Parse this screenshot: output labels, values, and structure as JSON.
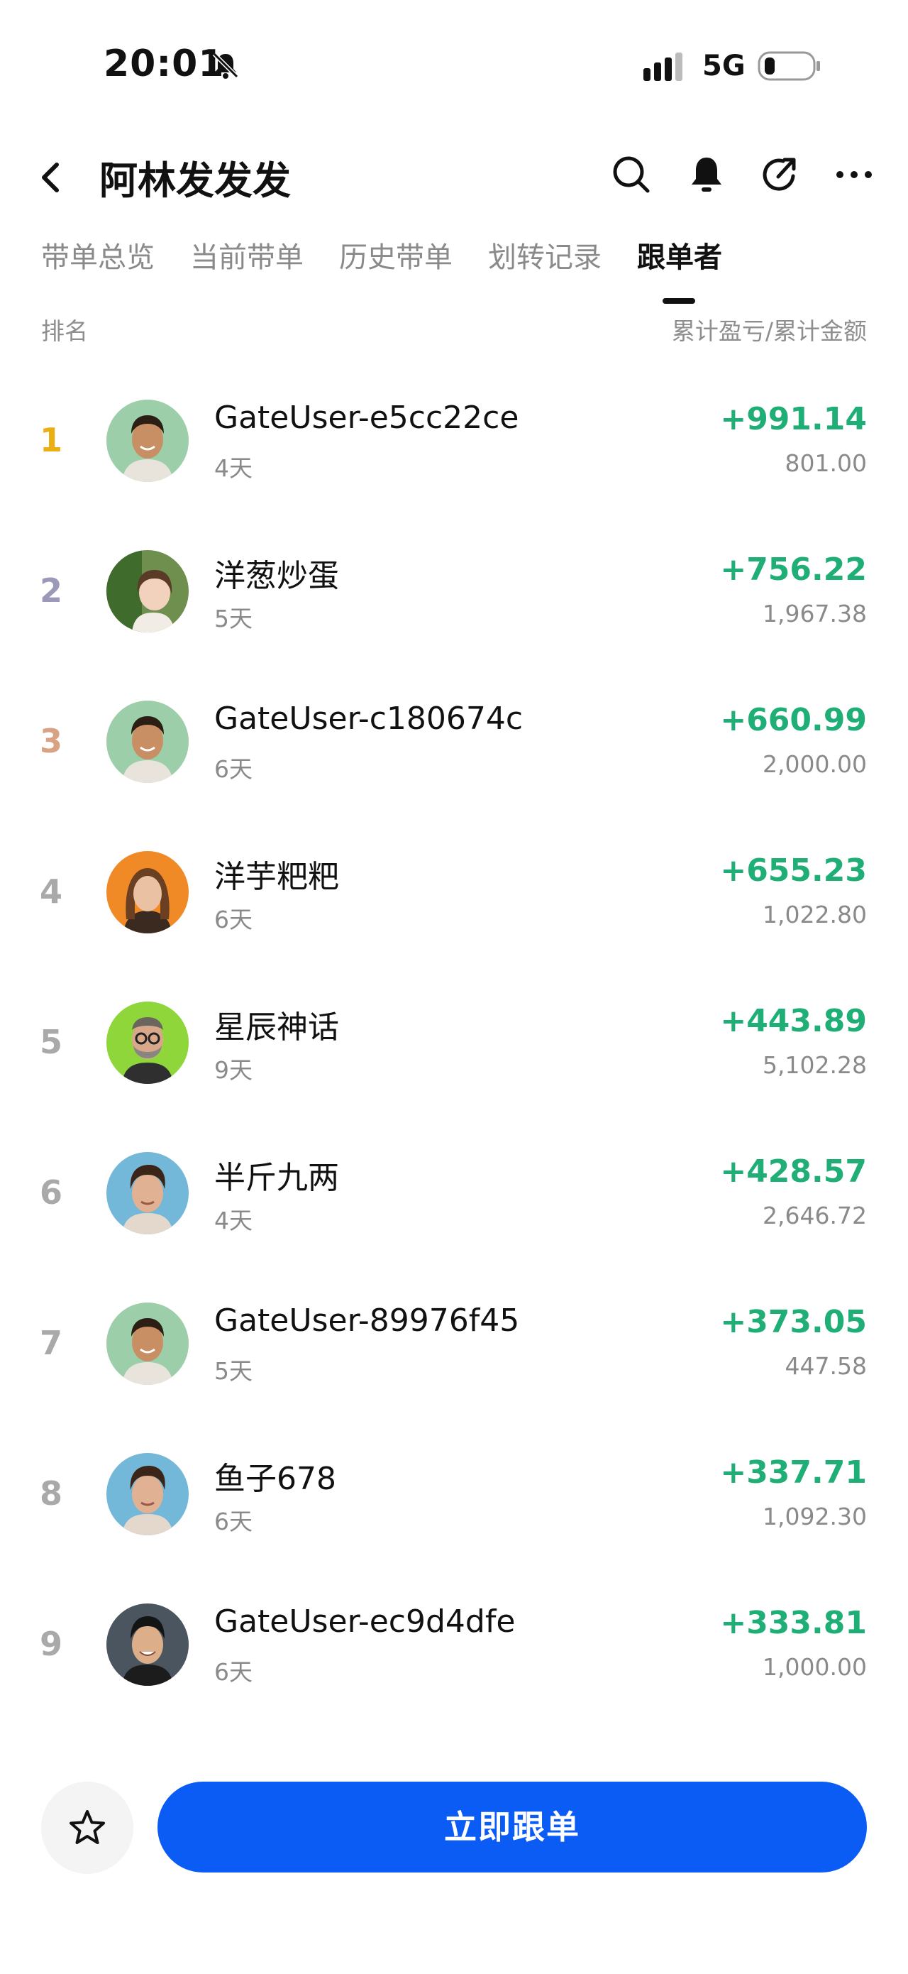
{
  "status_bar": {
    "time": "20:01",
    "network": "5G"
  },
  "header": {
    "title": "阿林发发发"
  },
  "tabs": [
    {
      "label": "带单总览"
    },
    {
      "label": "当前带单"
    },
    {
      "label": "历史带单"
    },
    {
      "label": "划转记录"
    },
    {
      "label": "跟单者"
    }
  ],
  "active_tab": "跟单者",
  "list_header": {
    "left": "排名",
    "right": "累计盈亏/累计金额"
  },
  "followers": [
    {
      "rank": "1",
      "name": "GateUser-e5cc22ce",
      "days": "4天",
      "pnl": "+991.14",
      "amount": "801.00"
    },
    {
      "rank": "2",
      "name": "洋葱炒蛋",
      "days": "5天",
      "pnl": "+756.22",
      "amount": "1,967.38"
    },
    {
      "rank": "3",
      "name": "GateUser-c180674c",
      "days": "6天",
      "pnl": "+660.99",
      "amount": "2,000.00"
    },
    {
      "rank": "4",
      "name": "洋芋粑粑",
      "days": "6天",
      "pnl": "+655.23",
      "amount": "1,022.80"
    },
    {
      "rank": "5",
      "name": "星辰神话",
      "days": "9天",
      "pnl": "+443.89",
      "amount": "5,102.28"
    },
    {
      "rank": "6",
      "name": "半斤九两",
      "days": "4天",
      "pnl": "+428.57",
      "amount": "2,646.72"
    },
    {
      "rank": "7",
      "name": "GateUser-89976f45",
      "days": "5天",
      "pnl": "+373.05",
      "amount": "447.58"
    },
    {
      "rank": "8",
      "name": "鱼子678",
      "days": "6天",
      "pnl": "+337.71",
      "amount": "1,092.30"
    },
    {
      "rank": "9",
      "name": "GateUser-ec9d4dfe",
      "days": "6天",
      "pnl": "+333.81",
      "amount": "1,000.00"
    }
  ],
  "bottom": {
    "follow_label": "立即跟单"
  },
  "colors": {
    "profit": "#1fae76",
    "primary": "#0b5bf5",
    "rank_gold": "#eab013",
    "rank_silver": "#9a9ab8",
    "rank_bronze": "#d9a383"
  },
  "icons": [
    "back-icon",
    "search-icon",
    "bell-icon",
    "share-icon",
    "more-icon",
    "star-icon",
    "mute-icon",
    "signal-icon",
    "battery-icon"
  ]
}
